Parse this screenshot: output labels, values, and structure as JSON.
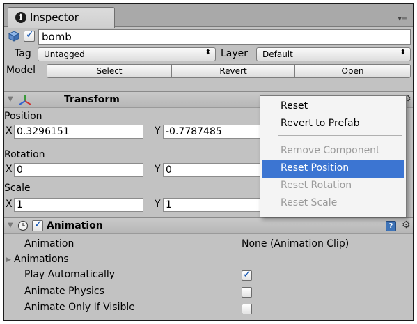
{
  "tab": {
    "title": "Inspector"
  },
  "object": {
    "name": "bomb",
    "active": true
  },
  "tag": {
    "label": "Tag",
    "value": "Untagged"
  },
  "layer": {
    "label": "Layer",
    "value": "Default"
  },
  "model": {
    "label": "Model",
    "buttons": [
      "Select",
      "Revert",
      "Open"
    ]
  },
  "transform": {
    "title": "Transform",
    "position": {
      "label": "Position",
      "x": "0.3296151",
      "y": "-0.7787485"
    },
    "rotation": {
      "label": "Rotation",
      "x": "0",
      "y": "0"
    },
    "scale": {
      "label": "Scale",
      "x": "1",
      "y": "1"
    },
    "axis_x": "X",
    "axis_y": "Y"
  },
  "animation": {
    "title": "Animation",
    "enabled": true,
    "rows": [
      {
        "label": "Animation",
        "value": "None (Animation Clip)"
      },
      {
        "label": "Animations"
      },
      {
        "label": "Play Automatically",
        "checked": true
      },
      {
        "label": "Animate Physics",
        "checked": false
      },
      {
        "label": "Animate Only If Visible",
        "checked": false
      }
    ]
  },
  "context_menu": {
    "items": [
      {
        "label": "Reset",
        "state": "enabled"
      },
      {
        "label": "Revert to Prefab",
        "state": "enabled"
      },
      {
        "label": "Remove Component",
        "state": "disabled"
      },
      {
        "label": "Reset Position",
        "state": "selected"
      },
      {
        "label": "Reset Rotation",
        "state": "disabled"
      },
      {
        "label": "Reset Scale",
        "state": "disabled"
      }
    ]
  },
  "colors": {
    "selection": "#3c75d2",
    "panel": "#c2c2c2",
    "header": "#bdbdbd"
  }
}
